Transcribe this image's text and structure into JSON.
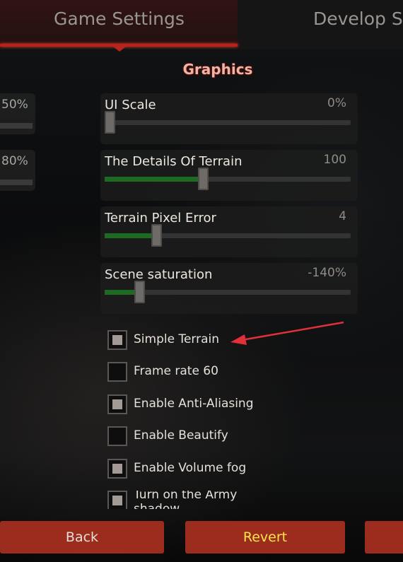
{
  "tabs": [
    {
      "label": "Game Settings",
      "active": true
    },
    {
      "label": "Develop S",
      "active": false
    }
  ],
  "section": {
    "title": "Graphics"
  },
  "left_column": [
    {
      "value": "50%"
    },
    {
      "value": "80%"
    }
  ],
  "sliders": [
    {
      "label": "UI Scale",
      "value": "0%",
      "level": 0.02
    },
    {
      "label": "The Details Of Terrain",
      "value": "100",
      "level": 0.4
    },
    {
      "label": "Terrain Pixel Error",
      "value": "4",
      "level": 0.21
    },
    {
      "label": "Scene saturation",
      "value": "-140%",
      "level": 0.14
    }
  ],
  "checkboxes": [
    {
      "label": "Simple Terrain",
      "checked": true
    },
    {
      "label": "Frame rate 60",
      "checked": false
    },
    {
      "label": "Enable Anti-Aliasing",
      "checked": true
    },
    {
      "label": "Enable Beautify",
      "checked": false
    },
    {
      "label": "Enable Volume fog",
      "checked": true
    },
    {
      "label": "Turn on the Army shadow",
      "checked": true
    }
  ],
  "buttons": {
    "back": "Back",
    "revert": "Revert"
  },
  "colors": {
    "accent_red": "#b6241c",
    "button_red": "#9b2c1e",
    "revert_text": "#ffe44d",
    "slider_fill": "#1f6a22",
    "annotation_arrow": "#e0303a"
  }
}
